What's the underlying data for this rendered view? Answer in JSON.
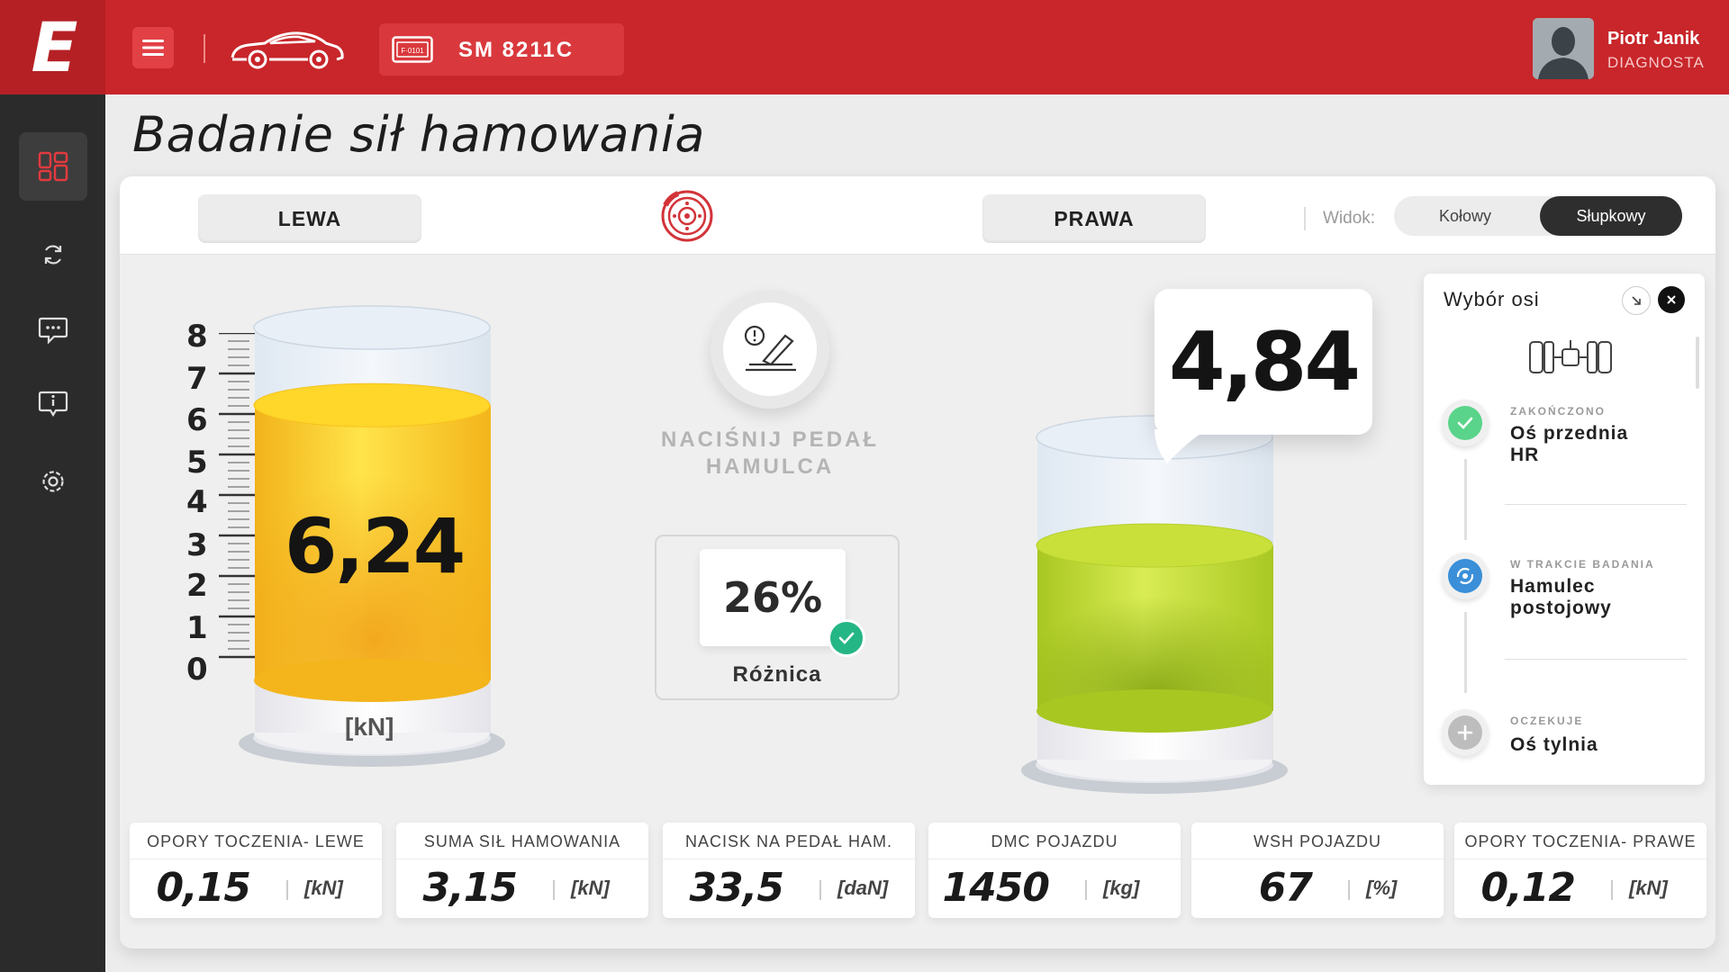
{
  "app": {
    "logo": "E"
  },
  "header": {
    "menu_icon": "hamburger-icon",
    "car_icon": "car-icon",
    "plate_icon": "license-plate-icon",
    "plate_number": "SM 8211C",
    "user": {
      "name": "Piotr Janik",
      "role": "DIAGNOSTA"
    }
  },
  "sidebar": {
    "items": [
      {
        "name": "dashboard-icon",
        "active": true
      },
      {
        "name": "sync-icon",
        "active": false
      },
      {
        "name": "chat-icon",
        "active": false
      },
      {
        "name": "info-message-icon",
        "active": false
      },
      {
        "name": "settings-icon",
        "active": false
      }
    ]
  },
  "page": {
    "title": "Badanie sił hamowania"
  },
  "tabs": {
    "left": "LEWA",
    "right": "PRAWA",
    "center_icon": "brake-disc-icon"
  },
  "view": {
    "label": "Widok:",
    "options": [
      "Kołowy",
      "Słupkowy"
    ],
    "selected": "Słupkowy"
  },
  "left_gauge": {
    "value": "6,24",
    "unit": "[kN]",
    "scale": [
      "8",
      "7",
      "6",
      "5",
      "4",
      "3",
      "2",
      "1",
      "0"
    ],
    "fill_fraction": 0.78,
    "color": "#f7c21a"
  },
  "right_gauge": {
    "value": "4,84",
    "fill_fraction": 0.605,
    "color": "#b6d22c"
  },
  "pedal": {
    "icon": "brake-pedal-icon",
    "text_line1": "NACIŚNIJ PEDAŁ",
    "text_line2": "HAMULCA"
  },
  "difference": {
    "value": "26%",
    "label": "Różnica",
    "status_icon": "check-icon"
  },
  "axis_panel": {
    "title": "Wybór osi",
    "steps": [
      {
        "status": "ZAKOŃCZONO",
        "name_line1": "Oś przednia",
        "name_line2": "HR",
        "state": "done"
      },
      {
        "status": "W TRAKCIE BADANIA",
        "name_line1": "Hamulec",
        "name_line2": "postojowy",
        "state": "active"
      },
      {
        "status": "OCZEKUJE",
        "name_line1": "Oś tylnia",
        "name_line2": "",
        "state": "pending"
      }
    ]
  },
  "stats": [
    {
      "title": "OPORY TOCZENIA- LEWE",
      "value": "0,15",
      "unit": "[kN]"
    },
    {
      "title": "SUMA SIŁ HAMOWANIA",
      "value": "3,15",
      "unit": "[kN]"
    },
    {
      "title": "NACISK NA PEDAŁ HAM.",
      "value": "33,5",
      "unit": "[daN]"
    },
    {
      "title": "DMC POJAZDU",
      "value": "1450",
      "unit": "[kg]"
    },
    {
      "title": "WSH POJAZDU",
      "value": "67",
      "unit": "[%]"
    },
    {
      "title": "OPORY TOCZENIA- PRAWE",
      "value": "0,12",
      "unit": "[kN]"
    }
  ],
  "colors": {
    "brand_red": "#c8262a",
    "sidebar": "#2b2b2b",
    "success": "#25b685",
    "progress_blue": "#3a8fd8"
  }
}
